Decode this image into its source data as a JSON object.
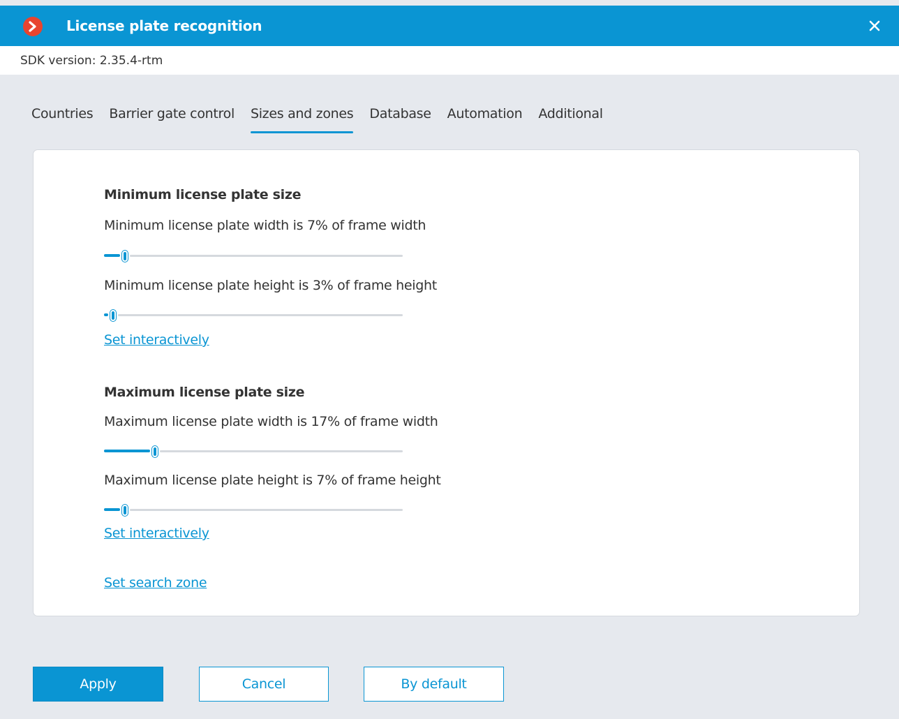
{
  "window": {
    "title": "License plate recognition",
    "app_icon": "chevron-right-icon",
    "close_icon": "close-icon"
  },
  "sdk": {
    "text": "SDK version:  2.35.4-rtm"
  },
  "tabs": [
    {
      "label": "Countries",
      "active": false
    },
    {
      "label": "Barrier gate control",
      "active": false
    },
    {
      "label": "Sizes and zones",
      "active": true
    },
    {
      "label": "Database",
      "active": false
    },
    {
      "label": "Automation",
      "active": false
    },
    {
      "label": "Additional",
      "active": false
    }
  ],
  "minimum": {
    "title": "Minimum license plate size",
    "width": {
      "label": "Minimum license plate width is 7% of frame width",
      "value": 0.07
    },
    "height": {
      "label": "Minimum license plate height is 3% of frame height",
      "value": 0.03
    },
    "link": "Set interactively"
  },
  "maximum": {
    "title": "Maximum license plate size",
    "width": {
      "label": "Maximum license plate width is 17% of frame width",
      "value": 0.17
    },
    "height": {
      "label": "Maximum license plate height is 7% of frame height",
      "value": 0.07
    },
    "link": "Set interactively"
  },
  "search_zone_link": "Set search zone",
  "buttons": {
    "apply": "Apply",
    "cancel": "Cancel",
    "default": "By default"
  },
  "colors": {
    "accent": "#0a95d3",
    "app_icon": "#e8442f",
    "background": "#e6e9ee"
  }
}
